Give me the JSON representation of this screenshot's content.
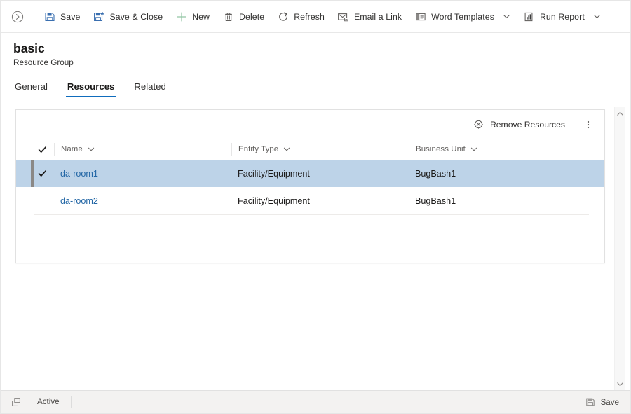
{
  "colors": {
    "accent": "#0f6cbd",
    "link": "#2266a5",
    "selected_row_bg": "#bdd3e8",
    "selection_marker": "#8a8886",
    "new_icon_green": "#92c5a4",
    "save_icon_blue": "#3a6fb0",
    "statusbar_bg": "#f3f2f1",
    "border": "#e1e1e1"
  },
  "commandbar": {
    "expand_icon": "chevron-circle-right-icon",
    "buttons": [
      {
        "label": "Save",
        "icon": "save-floppy-icon",
        "caret": false
      },
      {
        "label": "Save & Close",
        "icon": "save-and-close-icon",
        "caret": false
      },
      {
        "label": "New",
        "icon": "plus-icon",
        "caret": false
      },
      {
        "label": "Delete",
        "icon": "trash-icon",
        "caret": false
      },
      {
        "label": "Refresh",
        "icon": "refresh-icon",
        "caret": false
      },
      {
        "label": "Email a Link",
        "icon": "email-link-icon",
        "caret": false
      },
      {
        "label": "Word Templates",
        "icon": "word-template-icon",
        "caret": true
      },
      {
        "label": "Run Report",
        "icon": "run-report-icon",
        "caret": true
      }
    ]
  },
  "record": {
    "title": "basic",
    "subtitle": "Resource Group"
  },
  "tabs": [
    {
      "label": "General",
      "active": false
    },
    {
      "label": "Resources",
      "active": true
    },
    {
      "label": "Related",
      "active": false
    }
  ],
  "subgrid": {
    "toolbar": {
      "remove_label": "Remove Resources",
      "remove_icon": "remove-resources-icon",
      "more_icon": "more-vertical-icon"
    },
    "columns": [
      {
        "label": "Name",
        "sortable": true
      },
      {
        "label": "Entity Type",
        "sortable": true
      },
      {
        "label": "Business Unit",
        "sortable": true
      }
    ],
    "select_all_icon": "checkmark-icon",
    "rows": [
      {
        "selected": true,
        "check_icon": "checkmark-icon",
        "name": "da-room1",
        "entity_type": "Facility/Equipment",
        "business_unit": "BugBash1"
      },
      {
        "selected": false,
        "check_icon": "",
        "name": "da-room2",
        "entity_type": "Facility/Equipment",
        "business_unit": "BugBash1"
      }
    ]
  },
  "scrollbar": {
    "up_icon": "caret-up-icon",
    "down_icon": "caret-down-icon"
  },
  "statusbar": {
    "left_icon": "popout-icon",
    "status": "Active",
    "save_label": "Save",
    "save_icon": "save-floppy-icon"
  }
}
